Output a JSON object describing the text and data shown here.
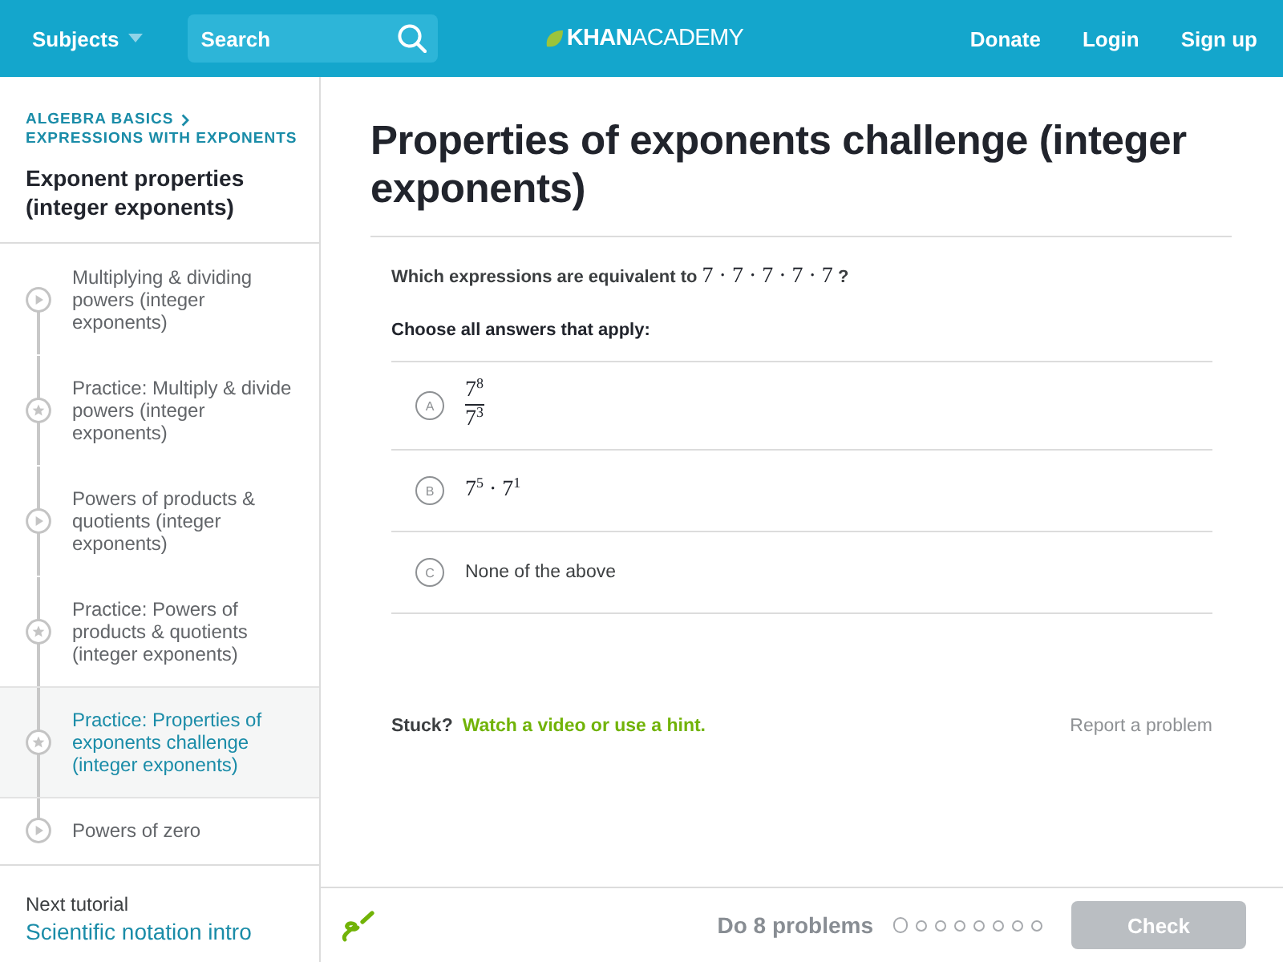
{
  "header": {
    "subjects": "Subjects",
    "search": {
      "placeholder": "Search"
    },
    "logo": "**KHAN**ACADEMY",
    "links": [
      "Donate",
      "Login",
      "Sign up"
    ]
  },
  "sidebar": {
    "breadcrumb": [
      "ALGEBRA BASICS",
      "EXPRESSIONS WITH EXPONENTS"
    ],
    "title": "Exponent properties (integer exponents)",
    "items": [
      {
        "kind": "video",
        "label": "Multiplying & dividing powers (integer exponents)",
        "selected": false
      },
      {
        "kind": "exercise",
        "label": "Practice: Multiply & divide powers (integer exponents)",
        "selected": false
      },
      {
        "kind": "video",
        "label": "Powers of products & quotients (integer exponents)",
        "selected": false
      },
      {
        "kind": "exercise",
        "label": "Practice: Powers of products & quotients (integer exponents)",
        "selected": false
      },
      {
        "kind": "exercise",
        "label": "Practice: Properties of exponents challenge (integer exponents)",
        "selected": true
      },
      {
        "kind": "video",
        "label": "Powers of zero",
        "selected": false
      }
    ],
    "next": {
      "label": "Next tutorial",
      "link": "Scientific notation intro"
    }
  },
  "exercise": {
    "title": "Properties of exponents challenge (integer exponents)",
    "question": {
      "text": "Which expressions are equivalent to",
      "math": "7 · 7 · 7 · 7 · 7",
      "end": "?"
    },
    "instruction": "Choose all answers that apply:",
    "choices": [
      {
        "letter": "A",
        "kind": "fraction",
        "numerator": "7$^{8}$",
        "denominator": "7$^{3}$",
        "selected": false
      },
      {
        "letter": "B",
        "kind": "math",
        "content": "7$^{5}$ · 7$^{1}$",
        "selected": false
      },
      {
        "letter": "C",
        "kind": "text",
        "content": "None of the above",
        "selected": false
      }
    ],
    "stuck": "Stuck?",
    "hint_link": "Watch a video or use a hint.",
    "report": "Report a problem"
  },
  "footer": {
    "goal": "Do 8 problems",
    "progress": [
      {
        "current": true
      },
      {
        "current": false
      },
      {
        "current": false
      },
      {
        "current": false
      },
      {
        "current": false
      },
      {
        "current": false
      },
      {
        "current": false
      },
      {
        "current": false
      }
    ],
    "check": {
      "label": "Check",
      "disabled": true
    }
  }
}
